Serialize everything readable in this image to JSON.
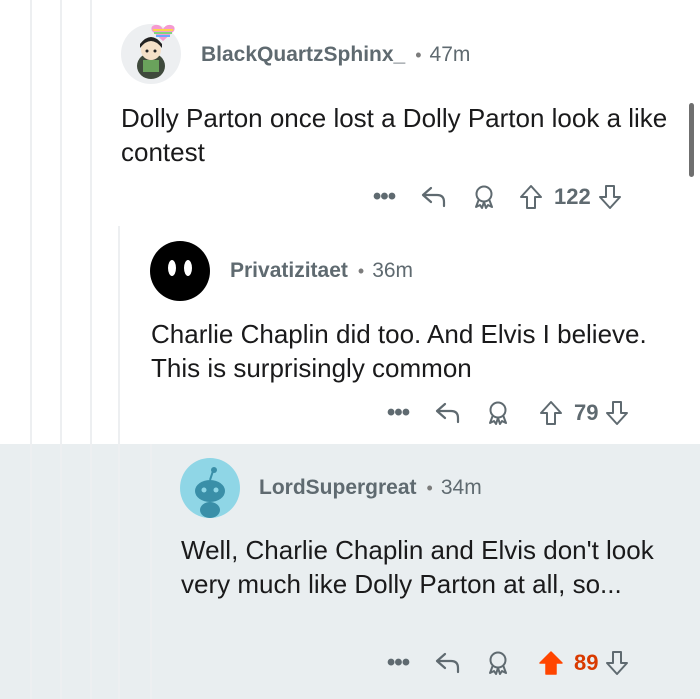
{
  "comments": [
    {
      "username": "BlackQuartzSphinx_",
      "time": "47m",
      "body": "Dolly Parton once lost a Dolly Parton look a like contest",
      "votes": "122",
      "upvoted": false
    },
    {
      "username": "Privatizitaet",
      "time": "36m",
      "body": "Charlie Chaplin did too. And Elvis I believe. This is surprisingly common",
      "votes": "79",
      "upvoted": false
    },
    {
      "username": "LordSupergreat",
      "time": "34m",
      "body": "Well, Charlie Chaplin and Elvis don't look very much like Dolly Parton at all, so...",
      "votes": "89",
      "upvoted": true
    }
  ],
  "separator": "•",
  "more_label": "•••",
  "colors": {
    "upvote_active": "#ff4500",
    "upvote_count_active": "#d93a00",
    "meta_gray": "#5f6a70",
    "highlight_background": "#e9eef0",
    "thread_line": "#edeff1"
  },
  "icons": [
    "more-icon",
    "reply-icon",
    "award-icon",
    "upvote-icon",
    "downvote-icon"
  ]
}
